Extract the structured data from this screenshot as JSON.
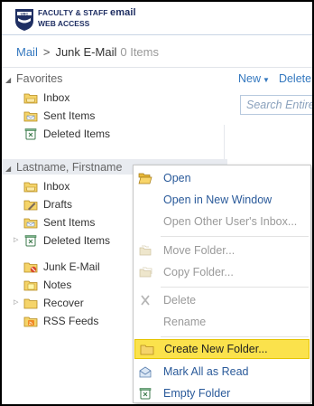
{
  "header": {
    "brand_line1_prefix": "UBC",
    "brand_line1": "FACULTY & STAFF",
    "brand_line1_em": "email",
    "brand_line2": "WEB ACCESS",
    "logo_text": "UBC"
  },
  "breadcrumb": {
    "root": "Mail",
    "separator": ">",
    "folder": "Junk E-Mail",
    "count": "0 Items"
  },
  "toolbar": {
    "new_label": "New",
    "delete_label": "Delete"
  },
  "search": {
    "placeholder": "Search Entire Mailbox"
  },
  "favorites": {
    "title": "Favorites",
    "items": [
      {
        "label": "Inbox",
        "icon": "inbox-folder-icon"
      },
      {
        "label": "Sent Items",
        "icon": "sent-items-icon"
      },
      {
        "label": "Deleted Items",
        "icon": "deleted-items-icon"
      }
    ]
  },
  "account": {
    "title": "Lastname, Firstname",
    "items": [
      {
        "label": "Inbox",
        "icon": "inbox-folder-icon"
      },
      {
        "label": "Drafts",
        "icon": "drafts-icon"
      },
      {
        "label": "Sent Items",
        "icon": "sent-items-icon"
      },
      {
        "label": "Deleted Items",
        "icon": "deleted-items-icon"
      },
      {
        "label": "Junk E-Mail",
        "icon": "junk-mail-icon"
      },
      {
        "label": "Notes",
        "icon": "notes-icon"
      },
      {
        "label": "Recover",
        "icon": "folder-icon"
      },
      {
        "label": "RSS Feeds",
        "icon": "rss-feeds-icon"
      }
    ]
  },
  "context_menu": {
    "items": [
      {
        "label": "Open",
        "enabled": true
      },
      {
        "label": "Open in New Window",
        "enabled": true
      },
      {
        "label": "Open Other User's Inbox...",
        "enabled": false
      },
      {
        "label": "Move Folder...",
        "enabled": false
      },
      {
        "label": "Copy Folder...",
        "enabled": false
      },
      {
        "label": "Delete",
        "enabled": false
      },
      {
        "label": "Rename",
        "enabled": false
      },
      {
        "label": "Create New Folder...",
        "enabled": true,
        "highlighted": true
      },
      {
        "label": "Mark All as Read",
        "enabled": true
      },
      {
        "label": "Empty Folder",
        "enabled": true
      }
    ]
  },
  "colors": {
    "link_blue": "#3478bf",
    "brand_navy": "#1f2f63",
    "highlight_yellow": "#fbe24c",
    "disabled_gray": "#9a9a9a"
  }
}
